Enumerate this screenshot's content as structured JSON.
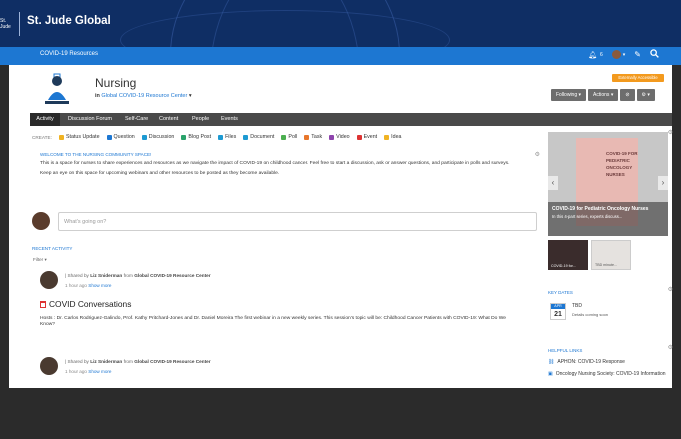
{
  "brand": {
    "title": "St. Jude Global",
    "logo_text": "St. Jude"
  },
  "nav": {
    "link": "COVID-19 Resources",
    "notif_count": "6"
  },
  "place": {
    "title": "Nursing",
    "sub_prefix": "in",
    "sub_link": "Global COVID-19 Resource Center",
    "badge": "Externally Accessible",
    "actions": [
      "Following ▾",
      "Actions ▾",
      "⊘",
      "⚙ ▾"
    ]
  },
  "tabs": [
    "Activity",
    "Discussion Forum",
    "Self-Care",
    "Content",
    "People",
    "Events"
  ],
  "create": {
    "label": "CREATE:",
    "items": [
      {
        "label": "Status Update",
        "color": "#f0b323"
      },
      {
        "label": "Question",
        "color": "#1d77d2"
      },
      {
        "label": "Discussion",
        "color": "#1d9ad2"
      },
      {
        "label": "Blog Post",
        "color": "#2aa36b"
      },
      {
        "label": "Files",
        "color": "#1d9ad2"
      },
      {
        "label": "Document",
        "color": "#1d9ad2"
      },
      {
        "label": "Poll",
        "color": "#4caf50"
      },
      {
        "label": "Task",
        "color": "#e8762b"
      },
      {
        "label": "Video",
        "color": "#8e44ad"
      },
      {
        "label": "Event",
        "color": "#d33"
      },
      {
        "label": "Idea",
        "color": "#f0b323"
      }
    ]
  },
  "welcome": {
    "title": "WELCOME TO THE NURSING COMMUNITY SPACE!",
    "p1": "This is a space for nurses to share experiences and resources as we navigate the impact of COVID-19 on childhood cancer. Feel free to start a discussion, ask or answer questions, and participate in polls and surveys.",
    "p2": "Keep an eye on this space for upcoming webinars and other resources to be posted as they become available."
  },
  "composer": {
    "placeholder": "What's going on?"
  },
  "recent": {
    "title": "RECENT ACTIVITY",
    "filter": "Filter ▾"
  },
  "posts": [
    {
      "shared_prefix": "| Shared by",
      "author": "Liz Sniderman",
      "from": "from",
      "source": "Global COVID-19 Resource Center",
      "time": "1 hour ago",
      "more": "Show more",
      "title": "COVID Conversations",
      "desc": "Hosts : Dr. Carlos Rodriguez-Galindo, Prof. Kathy Pritchard-Jones and Dr. Daniel Moreira The first webinar in a new weekly series. This session's topic will be: Childhood Cancer Patients with COVID-19: What Do We Know?"
    },
    {
      "shared_prefix": "| Shared by",
      "author": "Liz Sniderman",
      "from": "from",
      "source": "Global COVID-19 Resource Center",
      "time": "1 hour ago",
      "more": "Show more"
    }
  ],
  "sidebar": {
    "poster_text": "COVID-19 FOR PEDIATRIC ONCOLOGY NURSES",
    "caption_title": "COVID-19 for Pediatric Oncology Nurses",
    "caption_sub": "In this 4-part series, experts discuss...",
    "thumb1": "COVID-19 for...",
    "thumb2": "TBD minute...",
    "key_dates_title": "KEY DATES",
    "date_month": "APR",
    "date_day": "21",
    "date_title": "TBD",
    "date_sub": "Details coming soon",
    "helpful_title": "HELPFUL LINKS",
    "links": [
      "APHON: COVID-19 Response",
      "Oncology Nursing Society: COVID-19 Information"
    ]
  }
}
